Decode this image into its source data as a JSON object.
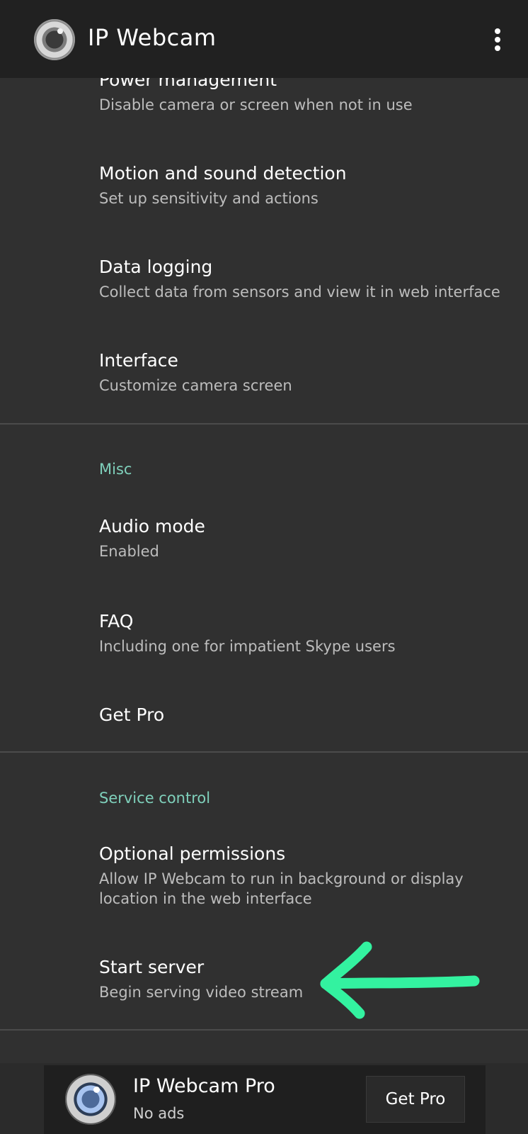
{
  "toolbar": {
    "app_title": "IP Webcam",
    "logo_icon": "camera-lens-icon",
    "menu_icon": "more-vert-icon"
  },
  "prefs": {
    "power_management": {
      "title": "Power management",
      "summary": "Disable camera or screen when not in use"
    },
    "motion_detection": {
      "title": "Motion and sound detection",
      "summary": "Set up sensitivity and actions"
    },
    "data_logging": {
      "title": "Data logging",
      "summary": "Collect data from sensors and view it in web interface"
    },
    "interface": {
      "title": "Interface",
      "summary": "Customize camera screen"
    }
  },
  "misc": {
    "category": "Misc",
    "audio_mode": {
      "title": "Audio mode",
      "summary": "Enabled"
    },
    "faq": {
      "title": "FAQ",
      "summary": "Including one for impatient Skype users"
    },
    "get_pro": {
      "title": "Get Pro"
    }
  },
  "service": {
    "category": "Service control",
    "optional_permissions": {
      "title": "Optional permissions",
      "summary": "Allow IP Webcam to run in background or display location in the web interface"
    },
    "start_server": {
      "title": "Start server",
      "summary": "Begin serving video stream"
    }
  },
  "ad": {
    "title": "IP Webcam Pro",
    "subtitle": "No ads",
    "button_label": "Get Pro",
    "logo_icon": "camera-lens-icon"
  },
  "colors": {
    "background": "#303030",
    "toolbar": "#212121",
    "category_accent": "#7fd0bb",
    "annotation_arrow": "#33f2a0"
  }
}
